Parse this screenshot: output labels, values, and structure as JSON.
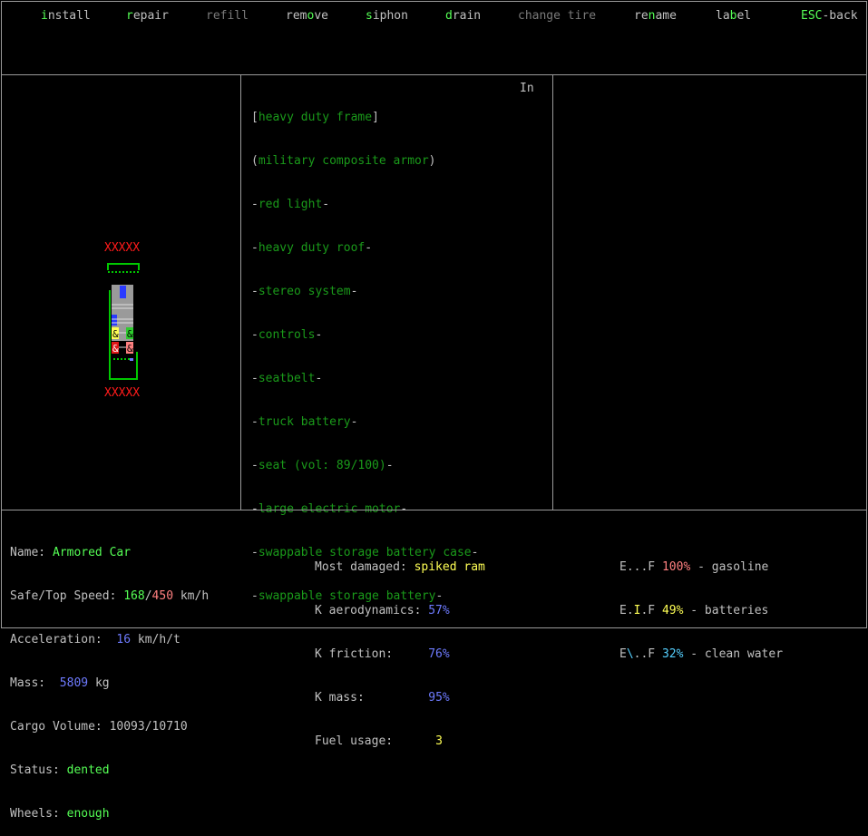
{
  "menu": [
    {
      "hotkey": "i",
      "rest": "nstall",
      "state": "enabled"
    },
    {
      "hotkey": "r",
      "rest": "epair",
      "state": "enabled"
    },
    {
      "hotkey": "",
      "rest": "refill",
      "state": "disabled"
    },
    {
      "pre": "rem",
      "hotkey": "o",
      "rest": "ve",
      "state": "enabled"
    },
    {
      "hotkey": "s",
      "rest": "iphon",
      "state": "enabled"
    },
    {
      "hotkey": "d",
      "rest": "rain",
      "state": "enabled"
    },
    {
      "hotkey": "",
      "rest": "change tire",
      "state": "disabled"
    },
    {
      "pre": "re",
      "hotkey": "n",
      "rest": "ame",
      "state": "enabled"
    },
    {
      "pre": "la",
      "hotkey": "b",
      "rest": "el",
      "state": "enabled"
    },
    {
      "hotkey": "ESC",
      "rest": "-back",
      "state": "enabled"
    }
  ],
  "parts": {
    "selected": "heavy duty frame",
    "armor": "military composite armor",
    "indicator": "In",
    "items": [
      "red light",
      "heavy duty roof",
      "stereo system",
      "controls",
      "seatbelt",
      "truck battery",
      "seat (vol: 89/100)",
      "large electric motor",
      "swappable storage battery case",
      "swappable storage battery"
    ]
  },
  "vehicle_map": {
    "top_marker": "XXXXX",
    "bottom_marker": "XXXXX"
  },
  "stats": {
    "name_label": "Name:",
    "name_value": "Armored Car",
    "speed_label": "Safe/Top Speed:",
    "speed_safe": "168",
    "speed_sep": "/",
    "speed_top": "450",
    "speed_unit": "km/h",
    "accel_label": "Acceleration:",
    "accel_value": "16",
    "accel_unit": "km/h/t",
    "mass_label": "Mass:",
    "mass_value": "5809",
    "mass_unit": "kg",
    "cargo_label": "Cargo Volume:",
    "cargo_value": "10093/10710",
    "status_label": "Status:",
    "status_value": "dented",
    "wheels_label": "Wheels:",
    "wheels_value": "enough"
  },
  "damage": {
    "most_damaged_label": "Most damaged:",
    "most_damaged_value": "spiked ram",
    "k_aero_label": "K aerodynamics:",
    "k_aero_value": "57%",
    "k_friction_label": "K friction:",
    "k_friction_value": "76%",
    "k_mass_label": "K mass:",
    "k_mass_value": "95%",
    "fuel_usage_label": "Fuel usage:",
    "fuel_usage_value": "3"
  },
  "fuel": [
    {
      "gauge_start": "E...F",
      "percent": "100%",
      "name": "- gasoline",
      "color": "#ff8080"
    },
    {
      "gauge_start": "E.",
      "gauge_mark": "I",
      "gauge_end": ".F",
      "percent": "49%",
      "name": "- batteries",
      "color": "#ffff55"
    },
    {
      "gauge_start": "E",
      "gauge_mark": "\\",
      "gauge_end": "..F",
      "percent": "32%",
      "name": "- clean water",
      "color": "#55d0ff"
    }
  ]
}
